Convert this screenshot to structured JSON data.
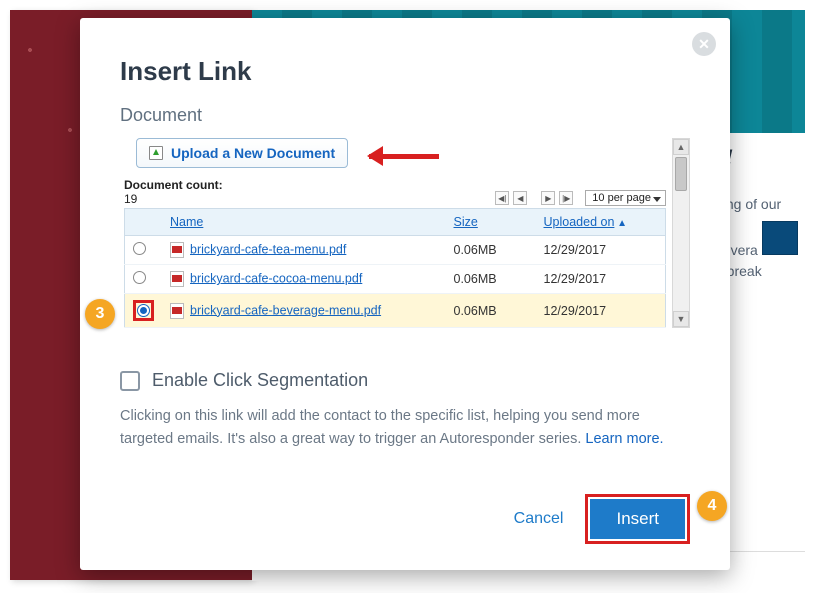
{
  "modal": {
    "title": "Insert Link",
    "section_label": "Document",
    "upload_label": "Upload a New Document",
    "count_label": "Document count:",
    "count_value": "19",
    "per_page": "10 per page",
    "columns": {
      "name": "Name",
      "size": "Size",
      "uploaded": "Uploaded on"
    },
    "rows": [
      {
        "name": "brickyard-cafe-tea-menu.pdf",
        "size": "0.06MB",
        "uploaded": "12/29/2017",
        "selected": false
      },
      {
        "name": "brickyard-cafe-cocoa-menu.pdf",
        "size": "0.06MB",
        "uploaded": "12/29/2017",
        "selected": false
      },
      {
        "name": "brickyard-cafe-beverage-menu.pdf",
        "size": "0.06MB",
        "uploaded": "12/29/2017",
        "selected": true
      }
    ],
    "segmentation": {
      "label": "Enable Click Segmentation",
      "help1": "Clicking on this link will add the contact to the specific list, helping you send more targeted emails. It's also a great way to trigger an Autoresponder series. ",
      "learn_more": "Learn more."
    },
    "footer": {
      "cancel": "Cancel",
      "insert": "Insert"
    }
  },
  "annotations": {
    "step3": "3",
    "step4": "4"
  },
  "side": {
    "brand": "d!",
    "text1": "ning of our",
    "text2": "bevera",
    "text3": "e break"
  }
}
